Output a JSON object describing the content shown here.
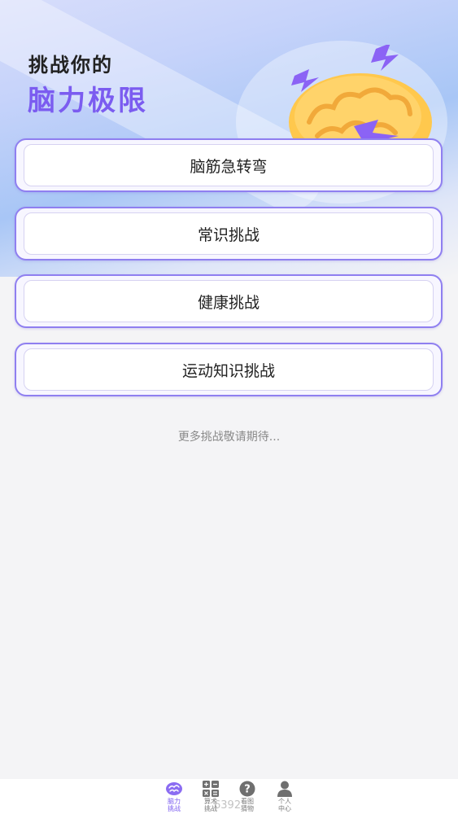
{
  "hero": {
    "title_line1": "挑战你的",
    "title_line2": "脑力极限"
  },
  "challenges": [
    {
      "label": "脑筋急转弯"
    },
    {
      "label": "常识挑战"
    },
    {
      "label": "健康挑战"
    },
    {
      "label": "运动知识挑战"
    }
  ],
  "more_hint": "更多挑战敬请期待...",
  "tabbar": {
    "tabs": [
      {
        "label": "脑力挑战",
        "icon": "brain-icon",
        "active": true
      },
      {
        "label": "算术挑战",
        "icon": "calculator-icon",
        "active": false
      },
      {
        "label": "看图猜物",
        "icon": "question-circle-icon",
        "active": false
      },
      {
        "label": "个人中心",
        "icon": "person-icon",
        "active": false
      }
    ]
  },
  "watermark": "6392",
  "colors": {
    "accent": "#7b5cf0",
    "card_border": "#8f7ff0",
    "background": "#f4f4f6"
  }
}
